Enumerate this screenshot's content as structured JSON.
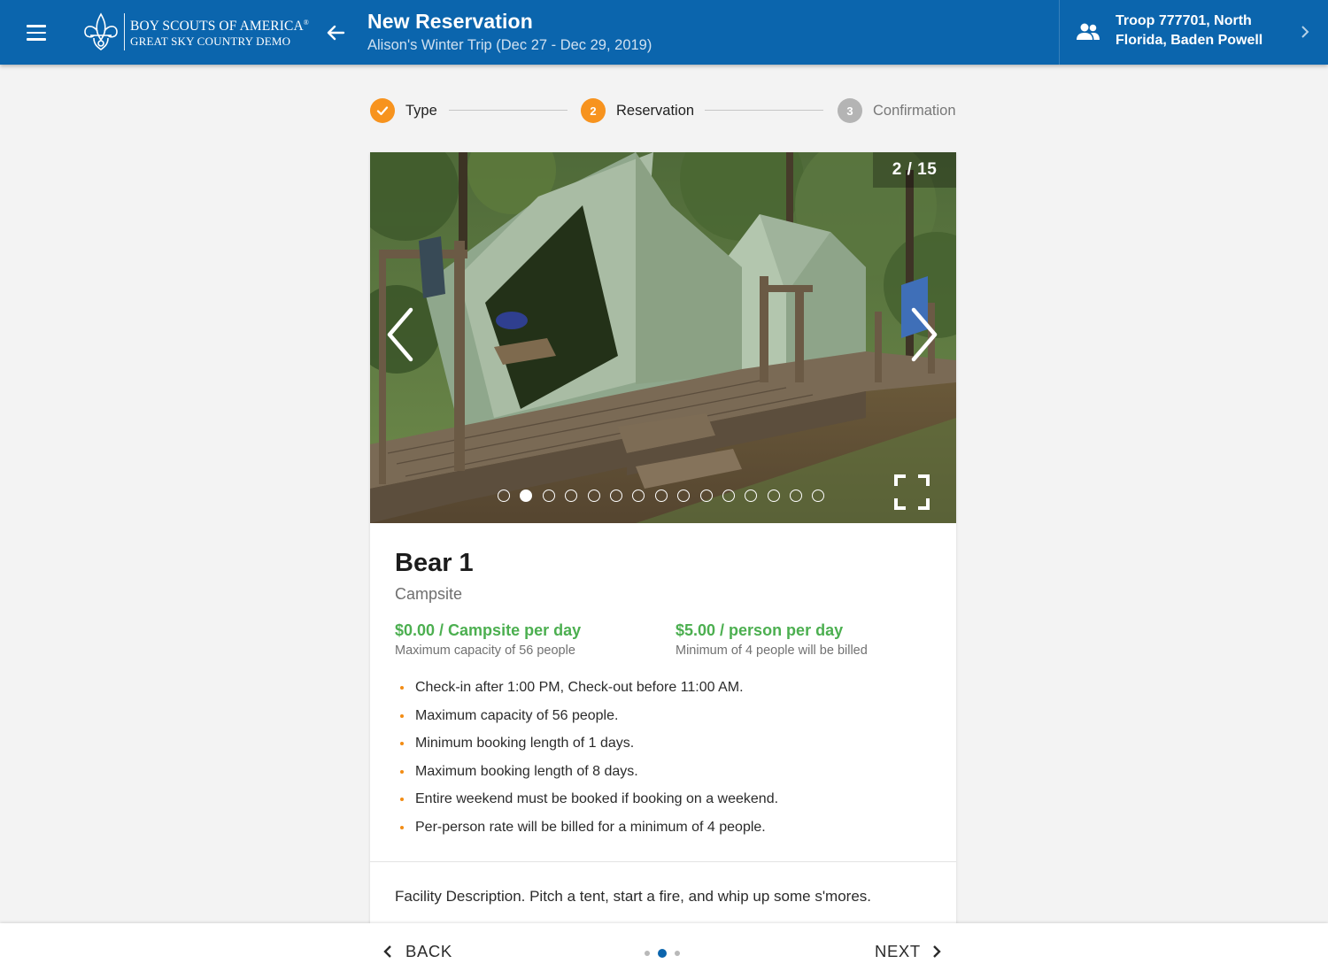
{
  "header": {
    "brand_line1": "BOY SCOUTS OF AMERICA",
    "brand_reg": "®",
    "brand_line2": "GREAT SKY COUNTRY DEMO",
    "title": "New Reservation",
    "subtitle": "Alison's Winter Trip (Dec 27 - Dec 29, 2019)",
    "troop_line1": "Troop 777701, North",
    "troop_line2": "Florida, Baden Powell",
    "bar_color": "#0b65ad"
  },
  "stepper": {
    "steps": [
      {
        "label": "Type",
        "state": "completed",
        "number": "1"
      },
      {
        "label": "Reservation",
        "state": "active",
        "number": "2"
      },
      {
        "label": "Confirmation",
        "state": "pending",
        "number": "3"
      }
    ],
    "accent_color": "#f7931e",
    "pending_color": "#b4b4b4"
  },
  "gallery": {
    "counter": "2 / 15",
    "total_images": 15,
    "current_index": 1,
    "icons": [
      "chevron-left-icon",
      "chevron-right-icon",
      "fullscreen-icon"
    ]
  },
  "facility": {
    "name": "Bear 1",
    "type": "Campsite",
    "price1": "$0.00 / Campsite per day",
    "price1_note": "Maximum capacity of 56 people",
    "price2": "$5.00 / person per day",
    "price2_note": "Minimum of 4 people will be billed",
    "price_color": "#4caf50",
    "rules": [
      "Check-in after 1:00 PM, Check-out before 11:00 AM.",
      "Maximum capacity of 56 people.",
      "Minimum booking length of 1 days.",
      "Maximum booking length of 8 days.",
      "Entire weekend must be booked if booking on a weekend.",
      "Per-person rate will be billed for a minimum of 4 people."
    ],
    "description": "Facility Description. Pitch a tent, start a fire, and whip up some s'mores."
  },
  "footer": {
    "back_label": "BACK",
    "next_label": "NEXT",
    "page_count": 3,
    "current_page": 1
  }
}
